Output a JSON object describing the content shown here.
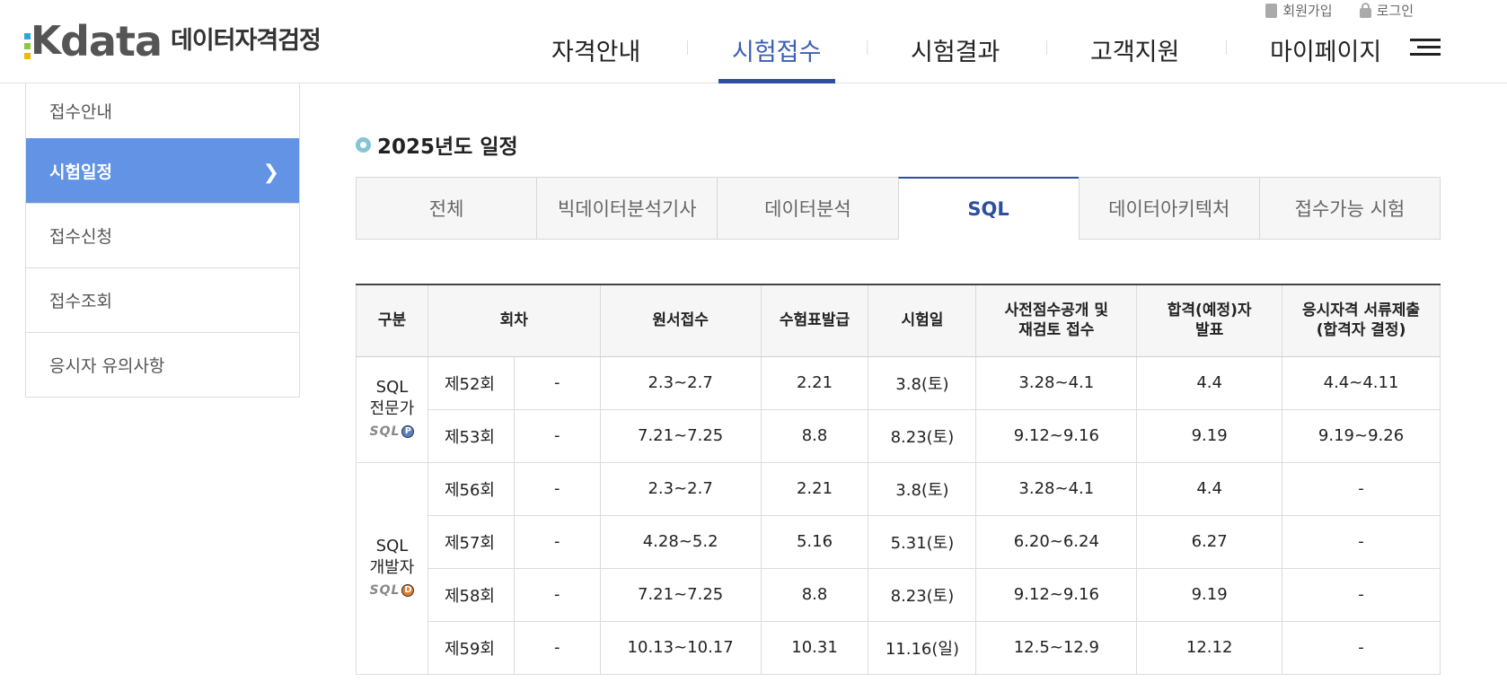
{
  "header": {
    "logo_text": "data",
    "logo_sub": "데이터자격검정",
    "util_links": [
      "회원가입",
      "로그인"
    ],
    "nav": [
      "자격안내",
      "시험접수",
      "시험결과",
      "고객지원",
      "마이페이지"
    ],
    "active_nav": "시험접수"
  },
  "sidebar": {
    "items": [
      {
        "label": "접수안내"
      },
      {
        "label": "시험일정"
      },
      {
        "label": "접수신청"
      },
      {
        "label": "접수조회"
      },
      {
        "label": "응시자 유의사항"
      }
    ]
  },
  "section_title": "2025년도 일정",
  "tabs": [
    "전체",
    "빅데이터분석기사",
    "데이터분석",
    "SQL",
    "데이터아키텍처",
    "접수가능 시험"
  ],
  "table": {
    "headers": [
      "구분",
      "회차",
      "원서접수",
      "수험표발급",
      "시험일",
      "사전점수공개 및",
      "재검토 접수",
      "합격(예정)자",
      "발표",
      "응시자격 서류제출",
      "(합격자 결정)"
    ],
    "groups": [
      {
        "name_line1": "SQL",
        "name_line2": "전문가",
        "mark_text": "SQL",
        "mark_badge": "P",
        "rows": [
          [
            "제52회",
            "-",
            "2.3~2.7",
            "2.21",
            "3.8(토)",
            "3.28~4.1",
            "4.4",
            "4.4~4.11"
          ],
          [
            "제53회",
            "-",
            "7.21~7.25",
            "8.8",
            "8.23(토)",
            "9.12~9.16",
            "9.19",
            "9.19~9.26"
          ]
        ]
      },
      {
        "name_line1": "SQL",
        "name_line2": "개발자",
        "mark_text": "SQL",
        "mark_badge": "D",
        "rows": [
          [
            "제56회",
            "-",
            "2.3~2.7",
            "2.21",
            "3.8(토)",
            "3.28~4.1",
            "4.4",
            "-"
          ],
          [
            "제57회",
            "-",
            "4.28~5.2",
            "5.16",
            "5.31(토)",
            "6.20~6.24",
            "6.27",
            "-"
          ],
          [
            "제58회",
            "-",
            "7.21~7.25",
            "8.8",
            "8.23(토)",
            "9.12~9.16",
            "9.19",
            "-"
          ],
          [
            "제59회",
            "-",
            "10.13~10.17",
            "10.31",
            "11.16(일)",
            "12.5~12.9",
            "12.12",
            "-"
          ]
        ]
      }
    ]
  },
  "colors": {
    "accent": "#2d4f9e",
    "sidebar_active": "#6293e4",
    "title_dot": "#86c5d8",
    "badge_p": "#5b7fc7",
    "badge_d": "#e07b2e"
  }
}
